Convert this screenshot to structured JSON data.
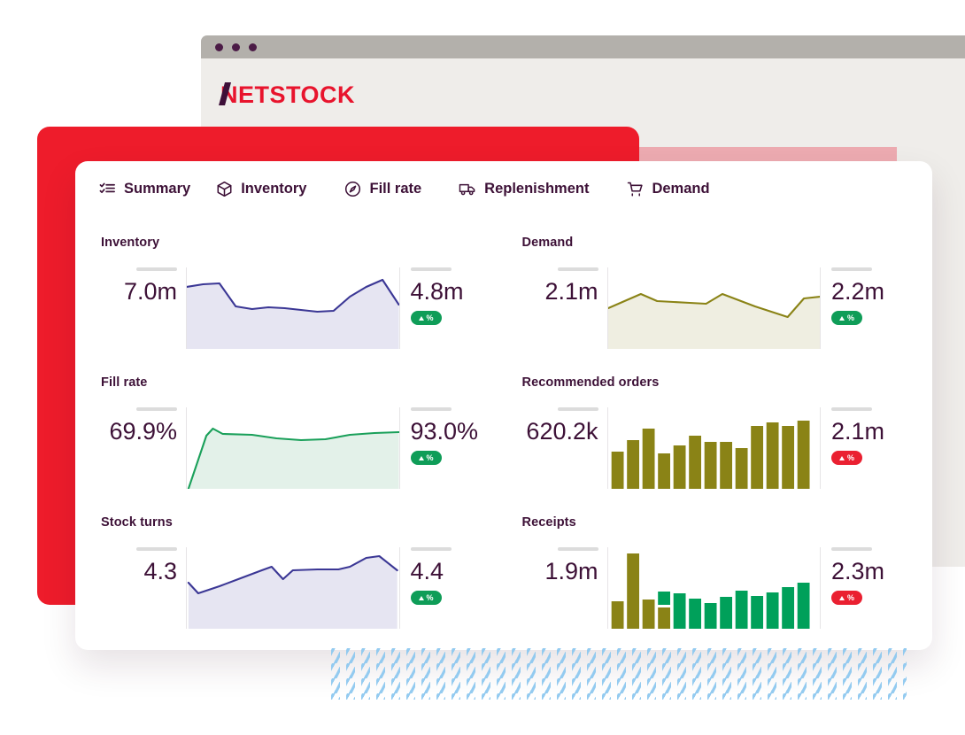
{
  "browser": {
    "logo_text": "NETSTOCK",
    "logo_n": "N",
    "logo_rest": "ETSTOCK",
    "brand_red": "#e8142d",
    "brand_dark": "#3d0f38"
  },
  "tabs": [
    {
      "label": "Summary",
      "icon": "checklist-icon",
      "active": true
    },
    {
      "label": "Inventory",
      "icon": "cube-icon",
      "active": false
    },
    {
      "label": "Fill rate",
      "icon": "gauge-icon",
      "active": false
    },
    {
      "label": "Replenishment",
      "icon": "truck-icon",
      "active": false
    },
    {
      "label": "Demand",
      "icon": "cart-icon",
      "active": false
    }
  ],
  "cards": [
    {
      "title": "Inventory",
      "start_value": "7.0m",
      "end_value": "4.8m",
      "trend": "up",
      "badge_symbol": "%"
    },
    {
      "title": "Demand",
      "start_value": "2.1m",
      "end_value": "2.2m",
      "trend": "up",
      "badge_symbol": "%"
    },
    {
      "title": "Fill rate",
      "start_value": "69.9%",
      "end_value": "93.0%",
      "trend": "up",
      "badge_symbol": "%"
    },
    {
      "title": "Recommended orders",
      "start_value": "620.2k",
      "end_value": "2.1m",
      "trend": "down",
      "badge_symbol": "%"
    },
    {
      "title": "Stock turns",
      "start_value": "4.3",
      "end_value": "4.4",
      "trend": "up",
      "badge_symbol": "%"
    },
    {
      "title": "Receipts",
      "start_value": "1.9m",
      "end_value": "2.3m",
      "trend": "down",
      "badge_symbol": "%"
    }
  ],
  "chart_data": [
    {
      "type": "area",
      "title": "Inventory",
      "line_color": "#3b3795",
      "fill_color": "#e6e5f2",
      "x": [
        0,
        1,
        2,
        3,
        4,
        5,
        6,
        7,
        8,
        9,
        10,
        11,
        12,
        13
      ],
      "values": [
        6.9,
        7.0,
        6.95,
        5.8,
        5.65,
        5.75,
        5.7,
        5.6,
        5.5,
        5.55,
        6.3,
        6.9,
        7.3,
        5.9
      ],
      "ylim": [
        4.0,
        8.0
      ],
      "grid": false,
      "legend": "none"
    },
    {
      "type": "area",
      "title": "Demand",
      "line_color": "#8a8316",
      "fill_color": "#efeee1",
      "x": [
        0,
        1,
        2,
        3,
        4,
        5,
        6,
        7,
        8,
        9,
        10,
        11,
        12,
        13
      ],
      "values": [
        2.02,
        2.12,
        2.22,
        2.12,
        2.11,
        2.1,
        2.09,
        2.2,
        2.13,
        2.06,
        2.0,
        1.95,
        2.16,
        2.18
      ],
      "ylim": [
        1.6,
        2.5
      ],
      "grid": false,
      "legend": "none"
    },
    {
      "type": "area",
      "title": "Fill rate",
      "line_color": "#1aa05a",
      "fill_color": "#e3f1e9",
      "x": [
        0,
        1,
        2,
        3,
        4,
        5,
        6,
        7,
        8,
        9,
        10,
        11,
        12,
        13
      ],
      "values": [
        60.0,
        88.0,
        92.5,
        91.0,
        90.6,
        90.2,
        89.6,
        89.5,
        89.8,
        90.3,
        91.3,
        91.6,
        91.7,
        91.8
      ],
      "ylim": [
        58.0,
        95.0
      ],
      "grid": false,
      "legend": "none"
    },
    {
      "type": "bar",
      "title": "Recommended orders",
      "bar_color": "#8a8316",
      "categories": [
        "1",
        "2",
        "3",
        "4",
        "5",
        "6",
        "7",
        "8",
        "9",
        "10",
        "11",
        "12",
        "13"
      ],
      "values": [
        0.95,
        1.25,
        1.55,
        0.92,
        1.12,
        1.38,
        1.22,
        1.22,
        1.05,
        1.62,
        1.7,
        1.6,
        1.75
      ],
      "ylim": [
        0,
        2.1
      ],
      "grid": false,
      "legend": "none"
    },
    {
      "type": "area",
      "title": "Stock turns",
      "line_color": "#3b3795",
      "fill_color": "#e6e5f2",
      "x": [
        0,
        1,
        2,
        3,
        4,
        5,
        6,
        7,
        8,
        9,
        10,
        11,
        12,
        13
      ],
      "values": [
        4.2,
        4.05,
        4.22,
        4.38,
        4.52,
        4.6,
        4.4,
        4.55,
        4.57,
        4.57,
        4.6,
        4.78,
        4.86,
        4.62
      ],
      "ylim": [
        3.9,
        5.0
      ],
      "grid": false,
      "legend": "none"
    },
    {
      "type": "bar",
      "title": "Receipts",
      "bar_colors": [
        "#8a8316",
        "#00a05a"
      ],
      "categories": [
        "1",
        "2",
        "3",
        "4",
        "5",
        "6",
        "7",
        "8",
        "9",
        "10",
        "11",
        "12",
        "13"
      ],
      "series": [
        {
          "name": "Olive",
          "values": [
            0.95,
            2.6,
            1.0,
            0.72,
            0,
            0,
            0,
            0,
            0,
            0,
            0,
            0,
            0
          ]
        },
        {
          "name": "Green",
          "values": [
            0,
            0,
            0,
            0.45,
            1.22,
            1.05,
            0.92,
            1.12,
            1.3,
            1.15,
            1.22,
            1.35,
            1.48
          ]
        }
      ],
      "ylim": [
        0,
        2.8
      ],
      "grid": false,
      "legend": "none"
    }
  ]
}
